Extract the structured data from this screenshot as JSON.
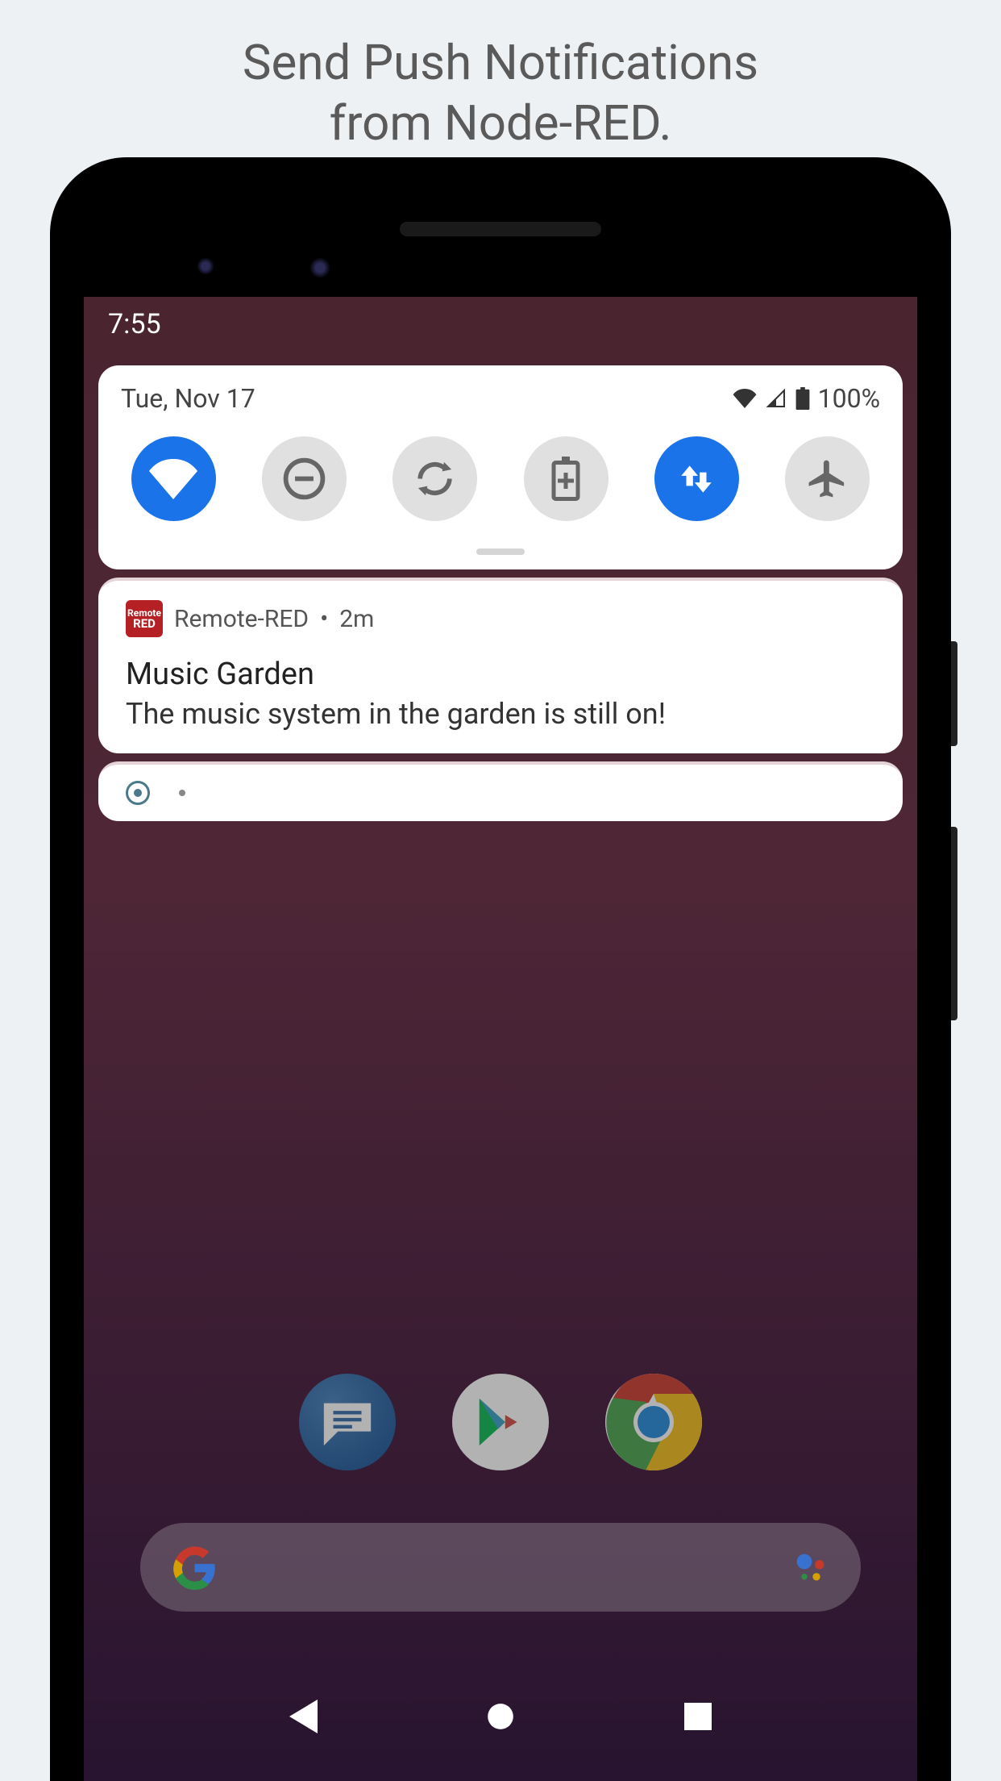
{
  "caption": {
    "line1": "Send Push Notifications",
    "line2": "from Node-RED."
  },
  "statusbar": {
    "time": "7:55"
  },
  "quicksettings": {
    "date": "Tue, Nov 17",
    "battery_pct": "100%",
    "toggles": [
      {
        "name": "wifi",
        "active": true
      },
      {
        "name": "dnd",
        "active": false
      },
      {
        "name": "autorotate",
        "active": false
      },
      {
        "name": "battery-saver",
        "active": false
      },
      {
        "name": "mobile-data",
        "active": true
      },
      {
        "name": "airplane",
        "active": false
      }
    ]
  },
  "notification": {
    "app_name": "Remote-RED",
    "timestamp": "2m",
    "title": "Music Garden",
    "body": "The music system in the garden is still on!",
    "icon_line1": "Remote",
    "icon_line2": "RED"
  }
}
